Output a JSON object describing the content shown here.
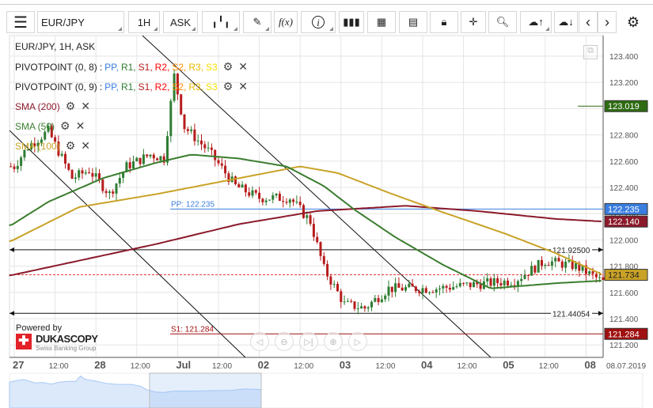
{
  "toolbar": {
    "menu_icon": "hamburger-icon",
    "symbol": "EUR/JPY",
    "timeframe": "1H",
    "side": "ASK",
    "tools": [
      "candlestick-type-icon",
      "draw-pen-icon",
      "function-indicator-icon",
      "info-icon",
      "bar-chart-icon",
      "calendar-icon",
      "news-icon",
      "lock-icon",
      "crosshair-icon",
      "zoom-chart-icon",
      "upload-cloud-icon",
      "download-cloud-icon",
      "chevron-left-icon",
      "chevron-right-icon",
      "gear-icon"
    ],
    "fx_label": "f(x)"
  },
  "legend": {
    "title": "EUR/JPY, 1H, ASK",
    "pivots": [
      {
        "label": "PIVOTPOINT (0, 8)"
      },
      {
        "label": "PIVOTPOINT (0, 9)"
      }
    ],
    "pivot_sep": ":",
    "pivot_items": [
      {
        "t": "PP",
        "c": "#3a7ee0"
      },
      {
        "t": "R1",
        "c": "#2e7d32"
      },
      {
        "t": "S1",
        "c": "#b71c1c"
      },
      {
        "t": "R2",
        "c": "#ff0000"
      },
      {
        "t": "S2",
        "c": "#ff8c00"
      },
      {
        "t": "R3",
        "c": "#e6b800"
      },
      {
        "t": "S3",
        "c": "#f5e000"
      }
    ],
    "smas": [
      {
        "label": "SMA (200)",
        "color": "#8b1a2b"
      },
      {
        "label": "SMA (50)",
        "color": "#3a7d2e"
      },
      {
        "label": "SMA (100)",
        "color": "#c9a227"
      }
    ]
  },
  "colors": {
    "up": "#2e7d32",
    "down": "#b71c1c",
    "sma200": "#8b1a2b",
    "sma100": "#c9a227",
    "sma50": "#3a7d2e",
    "pp": "#3a7ee0",
    "s1": "#a01010"
  },
  "chart_data": {
    "type": "candlestick",
    "ylim": [
      121.15,
      123.55
    ],
    "yticks": [
      "123.400",
      "123.200",
      "123.000",
      "122.800",
      "122.600",
      "122.400",
      "122.200",
      "122.000",
      "121.800",
      "121.600",
      "121.400",
      "121.200"
    ],
    "xticks": [
      {
        "t": "27",
        "b": true,
        "h": 0
      },
      {
        "t": "12:00",
        "h": 12
      },
      {
        "t": "28",
        "b": true,
        "h": 24
      },
      {
        "t": "12:00",
        "h": 36
      },
      {
        "t": "Jul",
        "b": true,
        "h": 48
      },
      {
        "t": "12:00",
        "h": 60
      },
      {
        "t": "02",
        "b": true,
        "h": 72
      },
      {
        "t": "12:00",
        "h": 84
      },
      {
        "t": "03",
        "b": true,
        "h": 96
      },
      {
        "t": "12:00",
        "h": 108
      },
      {
        "t": "04",
        "b": true,
        "h": 120
      },
      {
        "t": "12:00",
        "h": 132
      },
      {
        "t": "05",
        "b": true,
        "h": 144
      },
      {
        "t": "12:00",
        "h": 156
      },
      {
        "t": "08",
        "b": true,
        "h": 168
      }
    ],
    "date_label": "08.07.2019",
    "close_keypoints": [
      [
        0,
        122.56
      ],
      [
        4,
        122.71
      ],
      [
        10,
        122.83
      ],
      [
        17,
        122.47
      ],
      [
        22,
        122.53
      ],
      [
        28,
        122.35
      ],
      [
        33,
        122.56
      ],
      [
        40,
        122.65
      ],
      [
        44,
        122.62
      ],
      [
        47,
        123.25
      ],
      [
        50,
        122.86
      ],
      [
        57,
        122.68
      ],
      [
        65,
        122.41
      ],
      [
        72,
        122.32
      ],
      [
        81,
        122.32
      ],
      [
        87,
        122.14
      ],
      [
        91,
        121.78
      ],
      [
        97,
        121.51
      ],
      [
        103,
        121.48
      ],
      [
        110,
        121.63
      ],
      [
        124,
        121.63
      ],
      [
        135,
        121.66
      ],
      [
        147,
        121.69
      ],
      [
        156,
        121.84
      ],
      [
        165,
        121.8
      ],
      [
        173,
        121.68
      ]
    ],
    "sma200": [
      [
        -1,
        121.73
      ],
      [
        42,
        121.97
      ],
      [
        66,
        122.12
      ],
      [
        89,
        122.22
      ],
      [
        115,
        122.26
      ],
      [
        136,
        122.22
      ],
      [
        159,
        122.16
      ],
      [
        173,
        122.14
      ]
    ],
    "sma100": [
      [
        -1,
        121.99
      ],
      [
        19,
        122.25
      ],
      [
        42,
        122.35
      ],
      [
        66,
        122.47
      ],
      [
        84,
        122.56
      ],
      [
        95,
        122.51
      ],
      [
        111,
        122.35
      ],
      [
        126,
        122.21
      ],
      [
        144,
        122.05
      ],
      [
        159,
        121.9
      ],
      [
        173,
        121.734
      ]
    ],
    "sma50": [
      [
        -1,
        122.11
      ],
      [
        10,
        122.29
      ],
      [
        26,
        122.47
      ],
      [
        42,
        122.59
      ],
      [
        52,
        122.65
      ],
      [
        66,
        122.62
      ],
      [
        80,
        122.56
      ],
      [
        91,
        122.41
      ],
      [
        100,
        122.23
      ],
      [
        112,
        122.02
      ],
      [
        126,
        121.81
      ],
      [
        140,
        121.63
      ],
      [
        159,
        121.67
      ],
      [
        173,
        121.69
      ]
    ],
    "pp": {
      "label": "PP: 122.235",
      "value": 122.235
    },
    "s1": {
      "label": "S1: 121.284",
      "value": 121.284
    },
    "hlines": [
      {
        "label": "121.92500",
        "value": 121.925
      },
      {
        "label": "121.44054",
        "value": 121.44054
      }
    ],
    "current": 121.734,
    "price_labels": [
      {
        "t": "123.019",
        "v": 123.019,
        "c": "#2e6b12"
      },
      {
        "t": "122.235",
        "v": 122.235,
        "c": "#3a7ee0"
      },
      {
        "t": "122.140",
        "v": 122.14,
        "c": "#8b1a2b"
      },
      {
        "t": "121.734",
        "v": 121.734,
        "c": "#c9a227",
        "dark": true
      },
      {
        "t": "121.284",
        "v": 121.284,
        "c": "#a01010"
      }
    ]
  },
  "branding": {
    "powered": "Powered by",
    "name": "DUKASCOPY",
    "sub": "Swiss Banking Group"
  },
  "nav": [
    "scroll-left-icon",
    "zoom-out-icon",
    "scroll-end-icon",
    "zoom-in-icon",
    "scroll-right-icon"
  ]
}
